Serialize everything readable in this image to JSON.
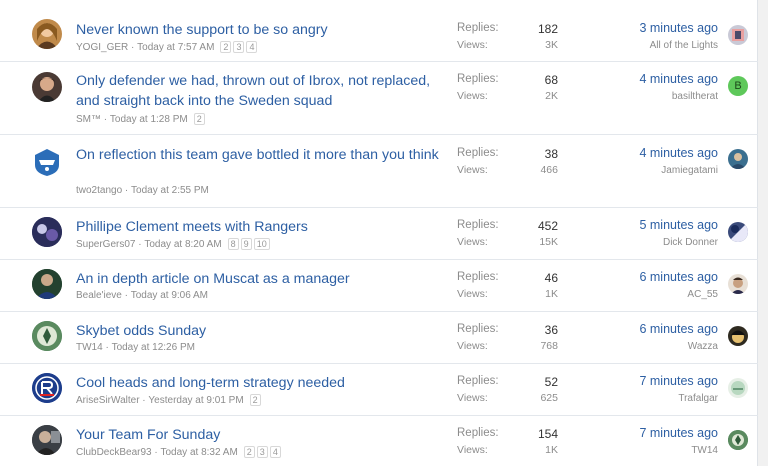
{
  "labels": {
    "replies": "Replies:",
    "views": "Views:"
  },
  "threads": [
    {
      "title": "Never known the support to be so angry",
      "author": "YOGI_GER",
      "started": "Today at 7:57 AM",
      "pages": [
        "2",
        "3",
        "4"
      ],
      "replies": "182",
      "views": "3K",
      "last_time": "3 minutes ago",
      "last_user": "All of the Lights",
      "avatar_color": "#c08a4a",
      "last_avatar_color": "#b9b9c9"
    },
    {
      "title": "Only defender we had, thrown out of Ibrox, not replaced, and straight back into the Sweden squad",
      "author": "SM™",
      "started": "Today at 1:28 PM",
      "pages": [
        "2"
      ],
      "replies": "68",
      "views": "2K",
      "last_time": "4 minutes ago",
      "last_user": "basiltherat",
      "avatar_color": "#4a3a34",
      "last_avatar_color": "#5ec85a",
      "last_avatar_letter": "B"
    },
    {
      "title": "On reflection this team gave bottled it more than you think",
      "author": "two2tango",
      "started": "Today at 2:55 PM",
      "pages": [],
      "replies": "38",
      "views": "466",
      "last_time": "4 minutes ago",
      "last_user": "Jamiegatami",
      "avatar_color": "#2b6db8",
      "last_avatar_color": "#3b6f8f"
    },
    {
      "title": "Phillipe Clement meets with Rangers",
      "author": "SuperGers07",
      "started": "Today at 8:20 AM",
      "pages": [
        "8",
        "9",
        "10"
      ],
      "replies": "452",
      "views": "15K",
      "last_time": "5 minutes ago",
      "last_user": "Dick Donner",
      "avatar_color": "#3b3f74",
      "last_avatar_color": "#3a4a7a"
    },
    {
      "title": "An in depth article on Muscat as a manager",
      "author": "Beale'ieve",
      "started": "Today at 9:06 AM",
      "pages": [],
      "replies": "46",
      "views": "1K",
      "last_time": "6 minutes ago",
      "last_user": "AC_55",
      "avatar_color": "#2f5b3e",
      "last_avatar_color": "#6b5a4a"
    },
    {
      "title": "Skybet odds Sunday",
      "author": "TW14",
      "started": "Today at 12:26 PM",
      "pages": [],
      "replies": "36",
      "views": "768",
      "last_time": "6 minutes ago",
      "last_user": "Wazza",
      "avatar_color": "#3f7a4f",
      "last_avatar_color": "#2e2a20"
    },
    {
      "title": "Cool heads and long-term strategy needed",
      "author": "AriseSirWalter",
      "started": "Yesterday at 9:01 PM",
      "pages": [
        "2"
      ],
      "replies": "52",
      "views": "625",
      "last_time": "7 minutes ago",
      "last_user": "Trafalgar",
      "avatar_color": "#1d3d8c",
      "last_avatar_color": "#b8d8c0"
    },
    {
      "title": "Your Team For Sunday",
      "author": "ClubDeckBear93",
      "started": "Today at 8:32 AM",
      "pages": [
        "2",
        "3",
        "4"
      ],
      "replies": "154",
      "views": "1K",
      "last_time": "7 minutes ago",
      "last_user": "TW14",
      "avatar_color": "#4a4a4a",
      "last_avatar_color": "#3f7a4f"
    }
  ]
}
